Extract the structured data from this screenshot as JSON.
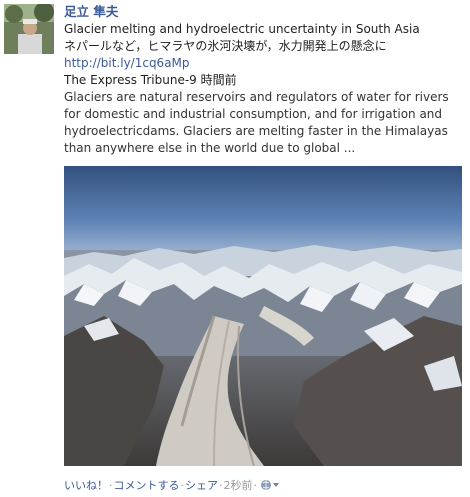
{
  "post": {
    "author": "足立 隼夫",
    "headline": "Glacier melting and hydroelectric uncertainty in South Asia",
    "japanese_summary": "ネパールなど，ヒマラヤの氷河決壊が，水力開発上の懸念に",
    "link": "http://bit.ly/1cq6aMp",
    "source": "The Express Tribune-9 時間前",
    "description": "Glaciers are natural reservoirs and regulators of water for rivers for domestic and industrial consumption, and for irrigation and hydroelectricdams. Glaciers are melting faster in the Himalayas than anywhere else in the world due to global ..."
  },
  "actions": {
    "like": "いいね！",
    "comment": "コメントする",
    "share": "シェア",
    "time": "2秒前",
    "separator": "·"
  },
  "colors": {
    "link": "#3b5998",
    "muted": "#999999"
  }
}
